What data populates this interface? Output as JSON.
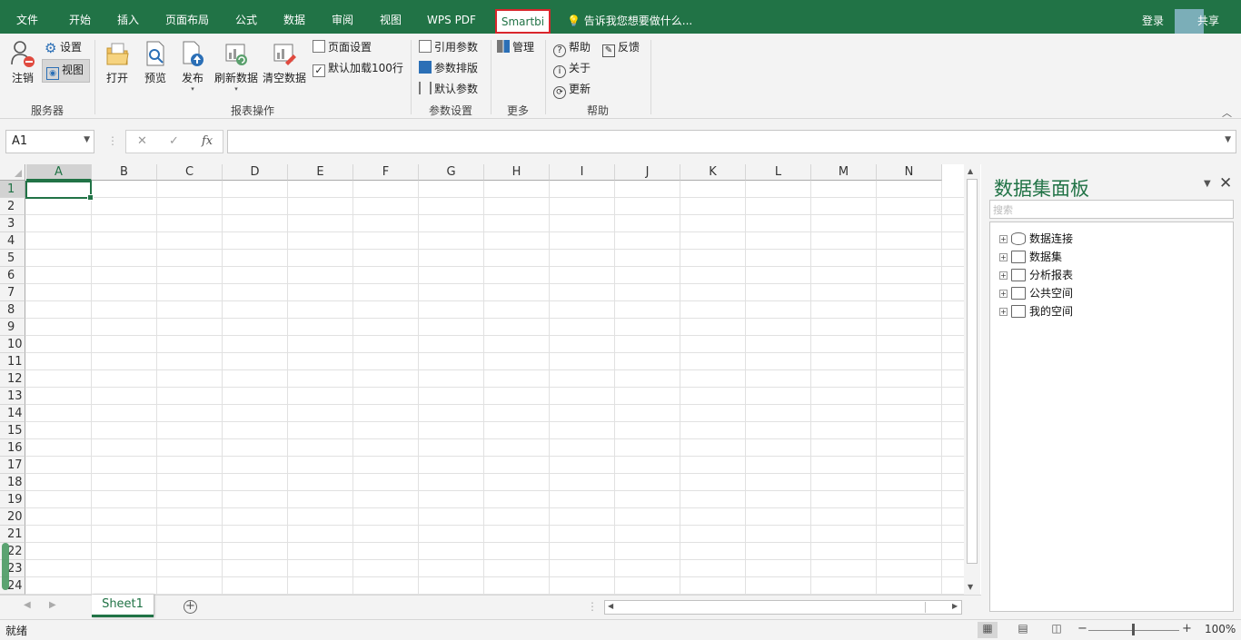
{
  "tabs": [
    "文件",
    "开始",
    "插入",
    "页面布局",
    "公式",
    "数据",
    "审阅",
    "视图",
    "WPS PDF",
    "Smartbi"
  ],
  "active_tab": "Smartbi",
  "tell_me": "告诉我您想要做什么...",
  "login": "登录",
  "share": "共享",
  "ribbon": {
    "server": {
      "logout": "注销",
      "settings": "设置",
      "view": "视图",
      "group": "服务器"
    },
    "report": {
      "open": "打开",
      "preview": "预览",
      "publish": "发布",
      "refresh": "刷新数据",
      "clear": "清空数据",
      "page_setup": "页面设置",
      "default_load": "默认加载100行",
      "group": "报表操作"
    },
    "params": {
      "ref": "引用参数",
      "layout": "参数排版",
      "default": "默认参数",
      "group": "参数设置"
    },
    "more": {
      "manage": "管理",
      "group": "更多"
    },
    "help": {
      "help": "帮助",
      "feedback": "反馈",
      "about": "关于",
      "update": "更新",
      "group": "帮助"
    }
  },
  "name_box": "A1",
  "fx": "fx",
  "columns": [
    "A",
    "B",
    "C",
    "D",
    "E",
    "F",
    "G",
    "H",
    "I",
    "J",
    "K",
    "L",
    "M",
    "N"
  ],
  "rows": [
    "1",
    "2",
    "3",
    "4",
    "5",
    "6",
    "7",
    "8",
    "9",
    "10",
    "11",
    "12",
    "13",
    "14",
    "15",
    "16",
    "17",
    "18",
    "19",
    "20",
    "21",
    "22",
    "23",
    "24"
  ],
  "sheet_tab": "Sheet1",
  "status": "就绪",
  "zoom": "100%",
  "panel": {
    "title": "数据集面板",
    "search_placeholder": "搜索",
    "nodes": [
      "数据连接",
      "数据集",
      "分析报表",
      "公共空间",
      "我的空间"
    ]
  },
  "colors": {
    "accent": "#217346",
    "highlight": "#d9262c"
  }
}
